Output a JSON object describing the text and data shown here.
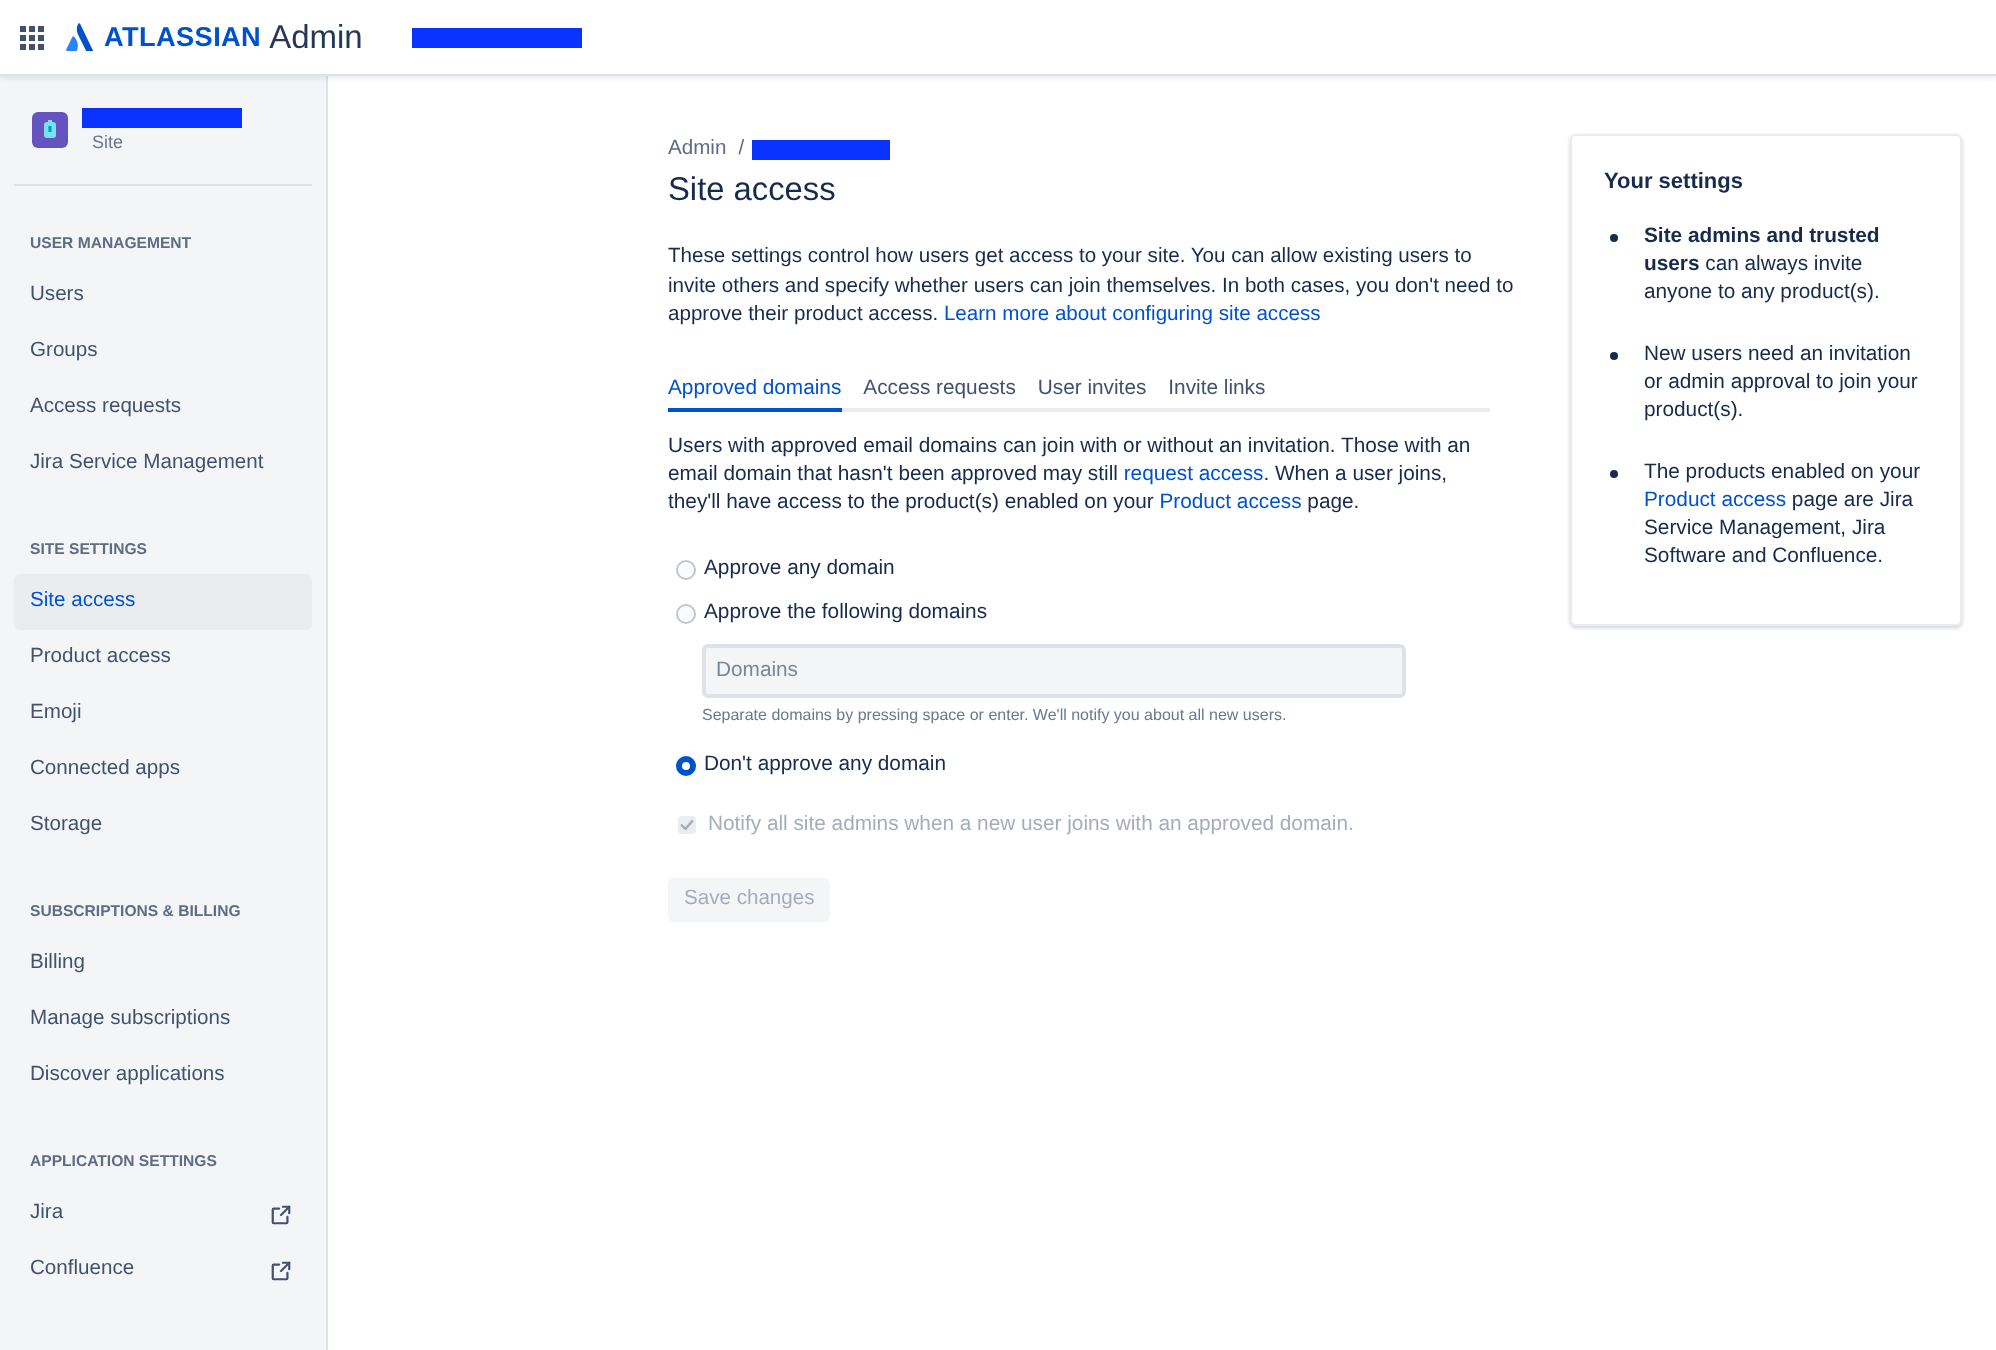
{
  "header": {
    "brand": "ATLASSIAN",
    "product": "Admin"
  },
  "sidebar": {
    "site_label": "Site",
    "sections": [
      {
        "title": "USER MANAGEMENT",
        "items": [
          {
            "label": "Users",
            "selected": false,
            "external": false
          },
          {
            "label": "Groups",
            "selected": false,
            "external": false
          },
          {
            "label": "Access requests",
            "selected": false,
            "external": false
          },
          {
            "label": "Jira Service Management",
            "selected": false,
            "external": false
          }
        ]
      },
      {
        "title": "SITE SETTINGS",
        "items": [
          {
            "label": "Site access",
            "selected": true,
            "external": false
          },
          {
            "label": "Product access",
            "selected": false,
            "external": false
          },
          {
            "label": "Emoji",
            "selected": false,
            "external": false
          },
          {
            "label": "Connected apps",
            "selected": false,
            "external": false
          },
          {
            "label": "Storage",
            "selected": false,
            "external": false
          }
        ]
      },
      {
        "title": "SUBSCRIPTIONS & BILLING",
        "items": [
          {
            "label": "Billing",
            "selected": false,
            "external": false
          },
          {
            "label": "Manage subscriptions",
            "selected": false,
            "external": false
          },
          {
            "label": "Discover applications",
            "selected": false,
            "external": false
          }
        ]
      },
      {
        "title": "APPLICATION SETTINGS",
        "items": [
          {
            "label": "Jira",
            "selected": false,
            "external": true
          },
          {
            "label": "Confluence",
            "selected": false,
            "external": true
          }
        ]
      }
    ]
  },
  "breadcrumb": {
    "root": "Admin",
    "separator": "/"
  },
  "page_title": "Site access",
  "intro": [
    {
      "kind": "text",
      "text": "These settings control how users get access to your site. You can allow existing users to invite others and specify whether users can join themselves. In both cases, you don't need to approve their product access. "
    },
    {
      "kind": "link",
      "text": "Learn more about configuring site access"
    }
  ],
  "tabs": [
    {
      "label": "Approved domains",
      "selected": true
    },
    {
      "label": "Access requests",
      "selected": false
    },
    {
      "label": "User invites",
      "selected": false
    },
    {
      "label": "Invite links",
      "selected": false
    }
  ],
  "description": [
    {
      "kind": "text",
      "text": "Users with approved email domains can join with or without an invitation. Those with an email domain that hasn't been approved may still "
    },
    {
      "kind": "link",
      "text": "request access"
    },
    {
      "kind": "text",
      "text": ". When a user joins, they'll have access to the product(s) enabled on your "
    },
    {
      "kind": "link",
      "text": "Product access"
    },
    {
      "kind": "text",
      "text": " page."
    }
  ],
  "options": [
    {
      "kind": "radio",
      "label": "Approve any domain",
      "selected": false
    },
    {
      "kind": "radio",
      "label": "Approve the following domains",
      "selected": false
    },
    {
      "kind": "domains_field",
      "placeholder": "Domains",
      "helper": "Separate domains by pressing space or enter. We'll notify you about all new users."
    },
    {
      "kind": "radio",
      "label": "Don't approve any domain",
      "selected": true
    },
    {
      "kind": "checkbox",
      "label": "Notify all site admins when a new user joins with an approved domain.",
      "checked": true,
      "disabled": true
    }
  ],
  "save_button": {
    "label": "Save changes",
    "disabled": true
  },
  "settings_card": {
    "title": "Your settings",
    "bullets": [
      [
        {
          "kind": "text",
          "text": "**Site admins and trusted users** can always invite anyone to any product(s)."
        }
      ],
      [
        {
          "kind": "text",
          "text": "New users need an invitation or admin approval to join your product(s)."
        }
      ],
      [
        {
          "kind": "text",
          "text": "The products enabled on your "
        },
        {
          "kind": "link",
          "text": "Product access"
        },
        {
          "kind": "text",
          "text": " page are Jira Service Management, Jira Software and Confluence."
        }
      ]
    ]
  }
}
